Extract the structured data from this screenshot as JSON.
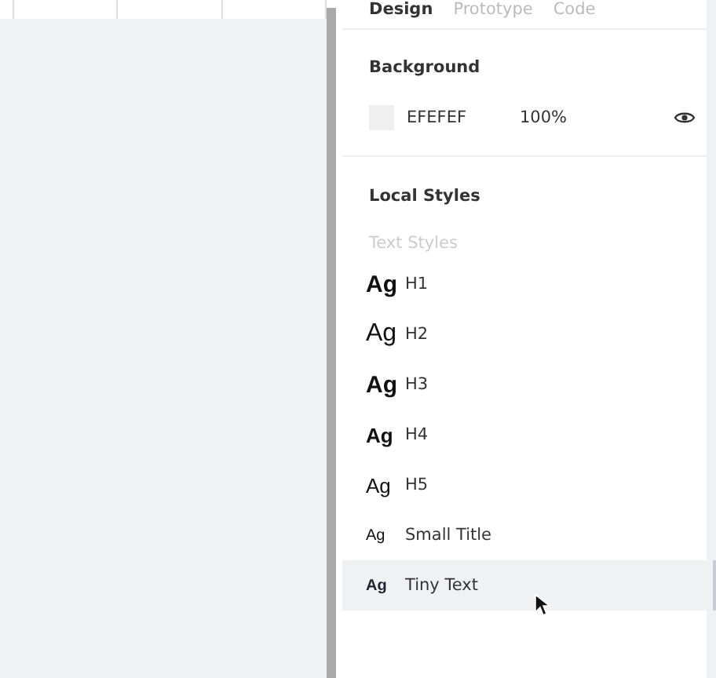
{
  "tabs": [
    {
      "label": "Design",
      "selected": true
    },
    {
      "label": "Prototype",
      "selected": false
    },
    {
      "label": "Code",
      "selected": false
    }
  ],
  "background": {
    "title": "Background",
    "hex": "EFEFEF",
    "opacity": "100%",
    "color": "#efefef",
    "visible": true
  },
  "local_styles": {
    "title": "Local Styles",
    "group_label": "Text Styles",
    "items": [
      {
        "sample": "Ag",
        "name": "H1",
        "kind": "h1",
        "hovered": false
      },
      {
        "sample": "Ag",
        "name": "H2",
        "kind": "h2",
        "hovered": false
      },
      {
        "sample": "Ag",
        "name": "H3",
        "kind": "h3",
        "hovered": false
      },
      {
        "sample": "Ag",
        "name": "H4",
        "kind": "h4",
        "hovered": false
      },
      {
        "sample": "Ag",
        "name": "H5",
        "kind": "h5",
        "hovered": false
      },
      {
        "sample": "Ag",
        "name": "Small Title",
        "kind": "small",
        "hovered": false
      },
      {
        "sample": "Ag",
        "name": "Tiny Text",
        "kind": "tiny",
        "hovered": true
      }
    ]
  }
}
